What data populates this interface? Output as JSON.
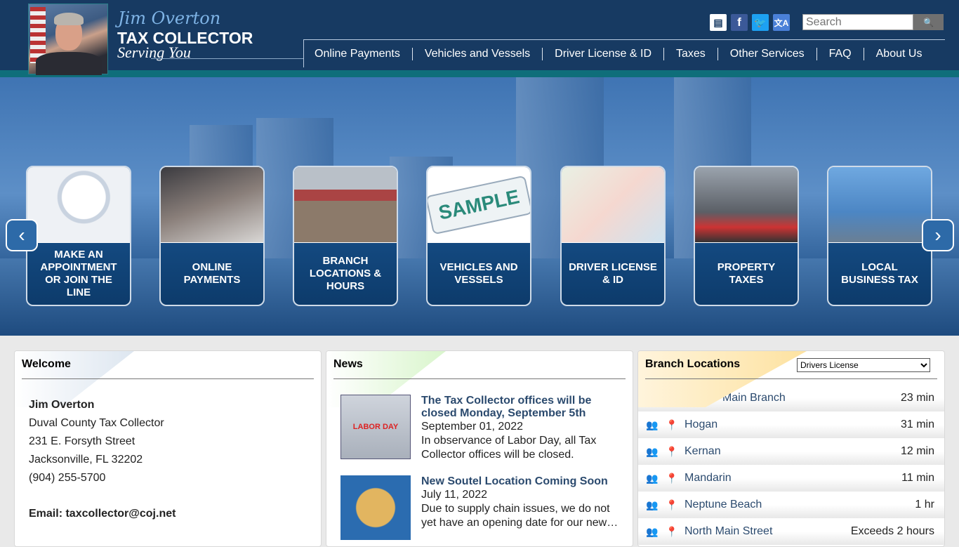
{
  "header": {
    "logo_script": "Jim Overton",
    "logo_title": "TAX COLLECTOR",
    "logo_tagline": "Serving You",
    "search_placeholder": "Search",
    "social_icons": [
      "news-icon",
      "facebook-icon",
      "twitter-icon",
      "translate-icon"
    ],
    "nav": [
      "Online Payments",
      "Vehicles and Vessels",
      "Driver License & ID",
      "Taxes",
      "Other Services",
      "FAQ",
      "About Us"
    ]
  },
  "carousel": {
    "tiles": [
      "Make an Appointment or Join the Line",
      "Online Payments",
      "Branch Locations & Hours",
      "Vehicles and Vessels",
      "Driver License & ID",
      "Property Taxes",
      "Local Business Tax"
    ],
    "sample_plate": "SAMPLE"
  },
  "welcome": {
    "title": "Welcome",
    "name": "Jim Overton",
    "lines": [
      "Duval County Tax Collector",
      "231 E. Forsyth Street",
      "Jacksonville, FL 32202",
      "(904) 255-5700"
    ],
    "email": "Email: taxcollector@coj.net"
  },
  "news": {
    "title": "News",
    "items": [
      {
        "title": "The Tax Collector offices will be closed Monday, September 5th",
        "date": "September 01, 2022",
        "text": "In observance of Labor Day, all Tax Collector offices will be closed.",
        "image_text": "LABOR DAY"
      },
      {
        "title": "New Soutel Location Coming Soon",
        "date": "July 11, 2022",
        "text": "Due to supply chain issues, we do not yet have an opening date for our new…"
      }
    ]
  },
  "branches": {
    "title": "Branch Locations",
    "selected": "Drivers License",
    "rows": [
      {
        "name": "Yates - Main Branch",
        "wait": "23 min"
      },
      {
        "name": "Hogan",
        "wait": "31 min"
      },
      {
        "name": "Kernan",
        "wait": "12 min"
      },
      {
        "name": "Mandarin",
        "wait": "11 min"
      },
      {
        "name": "Neptune Beach",
        "wait": "1 hr"
      },
      {
        "name": "North Main Street",
        "wait": "Exceeds 2 hours"
      }
    ]
  },
  "colors": {
    "header": "#173a62",
    "teal": "#0f6e7a",
    "link": "#2b4a6e"
  }
}
